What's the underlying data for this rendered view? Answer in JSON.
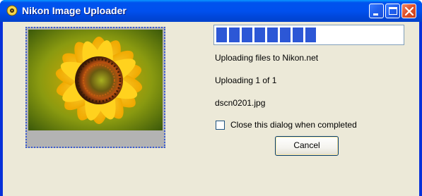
{
  "window": {
    "title": "Nikon Image Uploader",
    "icon": "nikon-uploader-icon"
  },
  "title_buttons": {
    "minimize": "minimize-icon",
    "maximize": "maximize-icon",
    "close": "close-icon"
  },
  "preview": {
    "subject": "sunflower-photo"
  },
  "progress": {
    "value": 0.52
  },
  "status": {
    "message": "Uploading files to Nikon.net",
    "count": "Uploading 1 of 1",
    "filename": "dscn0201.jpg"
  },
  "options": {
    "close_when_done_label": "Close this dialog when completed",
    "close_when_done_checked": false
  },
  "buttons": {
    "cancel": "Cancel"
  },
  "colors": {
    "titlebar": "#0050ee",
    "client_bg": "#ece9d8",
    "progress_block": "#2c57d6",
    "close_button": "#e0532c"
  }
}
